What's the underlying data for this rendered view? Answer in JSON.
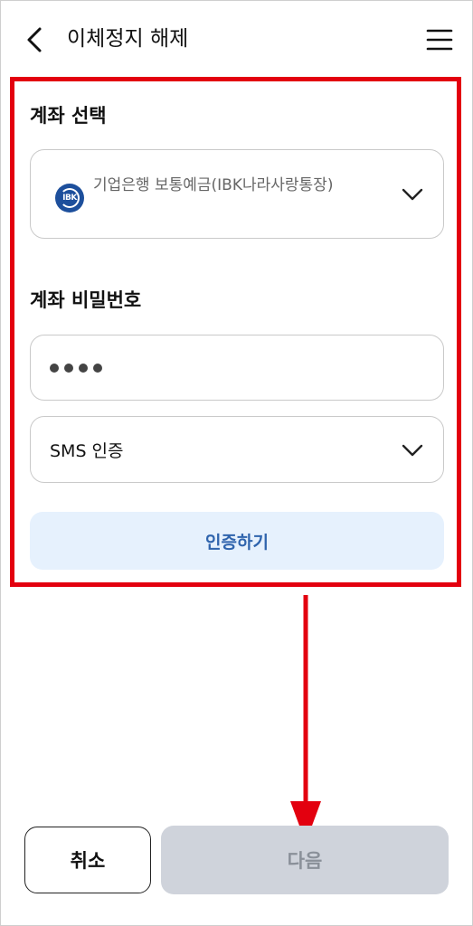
{
  "header": {
    "title": "이체정지 해제",
    "back_icon": "chevron-left-icon",
    "menu_icon": "hamburger-menu-icon"
  },
  "account_section": {
    "label": "계좌 선택",
    "selected_account": "기업은행 보통예금(IBK나라사랑통장)",
    "bank_logo_text": "IBK"
  },
  "password_section": {
    "label": "계좌 비밀번호",
    "masked_digits": 4
  },
  "auth": {
    "method": "SMS 인증",
    "verify_button": "인증하기"
  },
  "footer": {
    "cancel_label": "취소",
    "next_label": "다음"
  },
  "colors": {
    "highlight": "#e3000f",
    "verify_bg": "#e6f1fd",
    "verify_text": "#2f64ad",
    "next_disabled_bg": "#cfd3db",
    "bank_brand": "#1d4f9c"
  }
}
